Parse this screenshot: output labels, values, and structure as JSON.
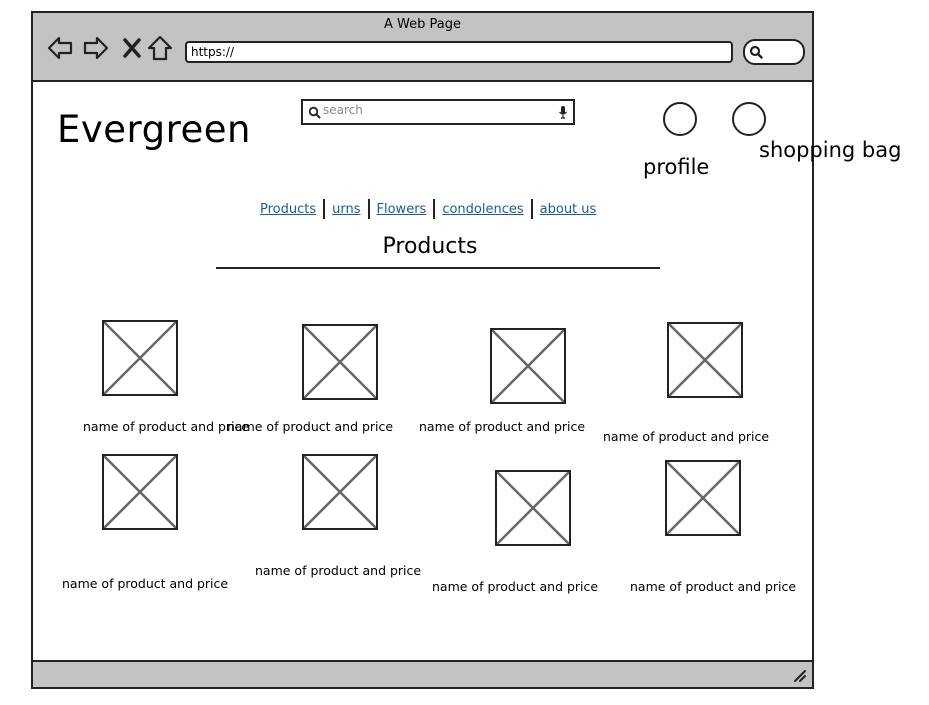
{
  "browser": {
    "title": "A Web Page",
    "url": "https://"
  },
  "site": {
    "logo": "Evergreen",
    "search_placeholder": "search",
    "profile_label": "profile",
    "bag_label": "shopping bag"
  },
  "nav": {
    "items": [
      "Products",
      "urns",
      "Flowers",
      "condolences",
      "about us"
    ]
  },
  "section": {
    "title": "Products"
  },
  "products": [
    {
      "caption": "name of product and price"
    },
    {
      "caption": "name of product and price"
    },
    {
      "caption": "name of product and price"
    },
    {
      "caption": "name of product and price"
    },
    {
      "caption": "name of product and price"
    },
    {
      "caption": "name of product and price"
    },
    {
      "caption": "name of product and price"
    },
    {
      "caption": "name of product and price"
    }
  ],
  "colors": {
    "chrome": "#c3c3c3",
    "link": "#1a5b9e",
    "border": "#222222"
  }
}
